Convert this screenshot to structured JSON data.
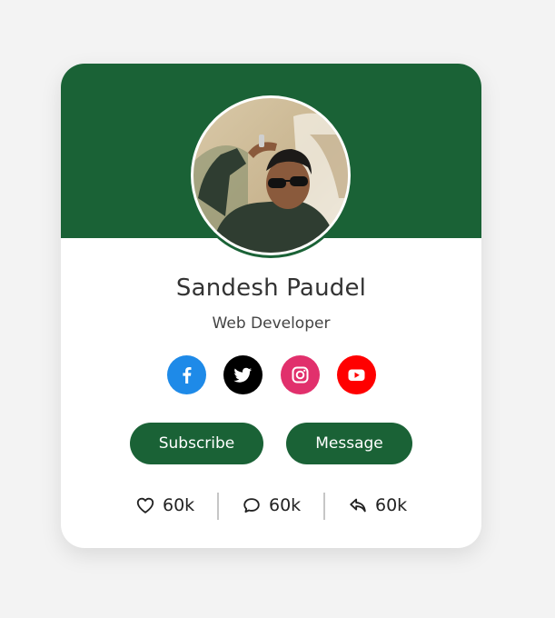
{
  "profile": {
    "name": "Sandesh Paudel",
    "role": "Web Developer"
  },
  "socials": [
    {
      "name": "facebook",
      "icon": "facebook-icon",
      "color": "#1e8ae8"
    },
    {
      "name": "twitter",
      "icon": "twitter-icon",
      "color": "#000000"
    },
    {
      "name": "instagram",
      "icon": "instagram-icon",
      "color": "#e1306c"
    },
    {
      "name": "youtube",
      "icon": "youtube-icon",
      "color": "#ff0000"
    }
  ],
  "buttons": {
    "subscribe_label": "Subscribe",
    "message_label": "Message"
  },
  "stats": {
    "likes": "60k",
    "comments": "60k",
    "shares": "60k"
  },
  "colors": {
    "brand": "#1a6236",
    "card": "#ffffff",
    "background": "#f3f3f3"
  }
}
